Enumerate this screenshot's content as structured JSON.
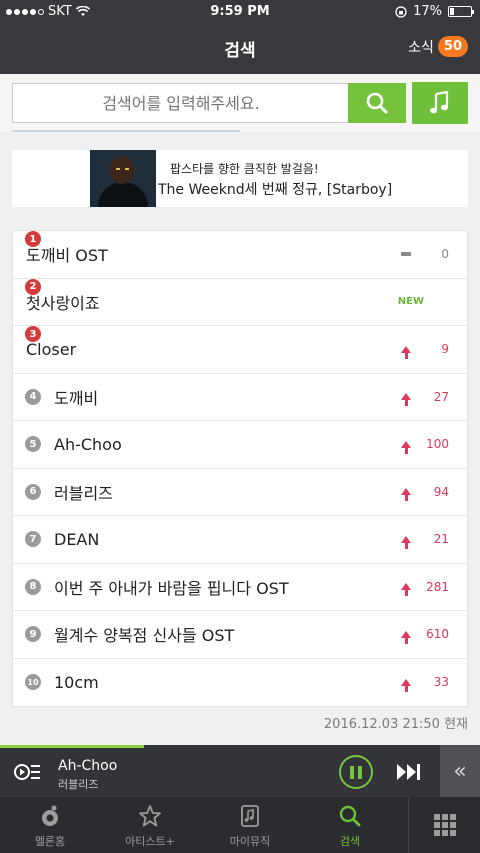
{
  "status_bar": {
    "carrier": "SKT",
    "time": "9:59 PM",
    "battery": "17%"
  },
  "header": {
    "title": "검색",
    "news_label": "소식",
    "news_count": "50"
  },
  "search": {
    "placeholder": "검색어를 입력해주세요."
  },
  "banner": {
    "line1": "팝스타를 향한 큼직한 발걸음!",
    "line2": "The Weeknd세 번째 정규, [Starboy]"
  },
  "rankings": [
    {
      "rank": "1",
      "title": "도깨비 OST",
      "change": "0",
      "status": "same"
    },
    {
      "rank": "2",
      "title": "첫사랑이죠",
      "change": "NEW",
      "status": "new"
    },
    {
      "rank": "3",
      "title": "Closer",
      "change": "9",
      "status": "up"
    },
    {
      "rank": "4",
      "title": "도깨비",
      "change": "27",
      "status": "up"
    },
    {
      "rank": "5",
      "title": "Ah-Choo",
      "change": "100",
      "status": "up"
    },
    {
      "rank": "6",
      "title": "러블리즈",
      "change": "94",
      "status": "up"
    },
    {
      "rank": "7",
      "title": "DEAN",
      "change": "21",
      "status": "up"
    },
    {
      "rank": "8",
      "title": "이번 주 아내가 바람을 핍니다 OST",
      "change": "281",
      "status": "up"
    },
    {
      "rank": "9",
      "title": "월계수 양복점 신사들 OST",
      "change": "610",
      "status": "up"
    },
    {
      "rank": "10",
      "title": "10cm",
      "change": "33",
      "status": "up"
    }
  ],
  "timestamp": "2016.12.03 21:50 현재",
  "player": {
    "song": "Ah-Choo",
    "artist": "러블리즈",
    "progress": 0.3
  },
  "nav": {
    "items": [
      {
        "label": "멜론홈",
        "icon": "melon-home-icon"
      },
      {
        "label": "아티스트+",
        "icon": "star-icon"
      },
      {
        "label": "마이뮤직",
        "icon": "my-music-icon"
      },
      {
        "label": "검색",
        "icon": "search-icon",
        "active": true
      }
    ]
  },
  "colors": {
    "accent_green": "#6ec03a",
    "rank_top": "#d63b3b",
    "rank_up": "#e1365c",
    "header_bg": "#38393d",
    "badge_orange": "#f47920"
  }
}
